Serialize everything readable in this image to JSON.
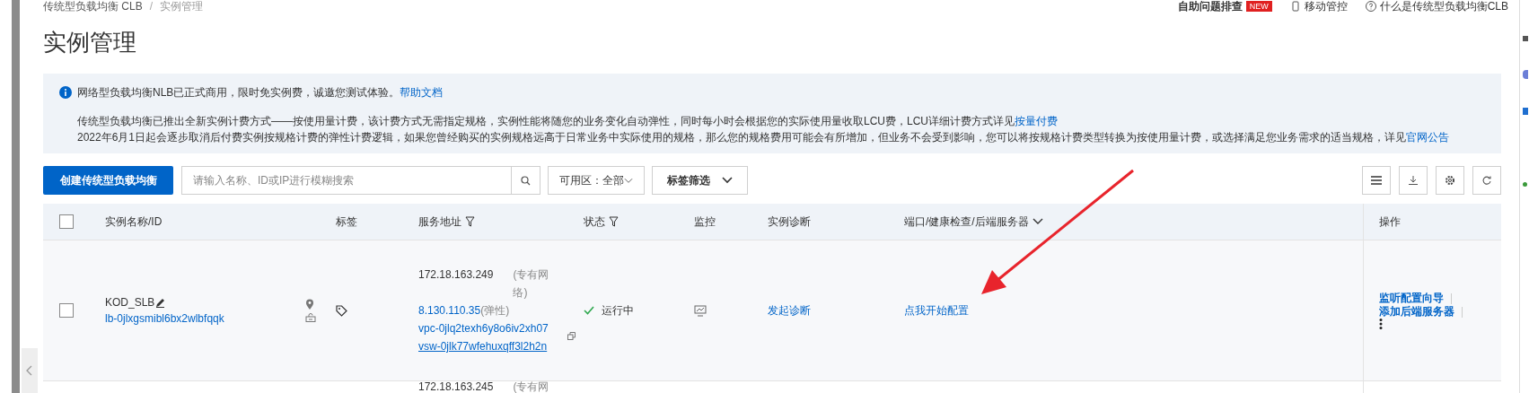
{
  "breadcrumb": {
    "separator": "/",
    "items": [
      {
        "label": "传统型负载均衡 CLB"
      },
      {
        "label": "实例管理"
      }
    ]
  },
  "top_links": [
    {
      "label": "自助问题排查",
      "badge": "NEW"
    },
    {
      "label": "移动管控"
    },
    {
      "label": "什么是传统型负载均衡CLB"
    }
  ],
  "page_title": "实例管理",
  "notice": {
    "line1": "网络型负载均衡NLB已正式商用，限时免实例费，诚邀您测试体验。",
    "line1_link": "帮助文档",
    "line2": "传统型负载均衡已推出全新实例计费方式——按使用量计费，该计费方式无需指定规格，实例性能将随您的业务变化自动弹性，同时每小时会根据您的实际使用量收取LCU费，LCU详细计费方式详见",
    "line2_link": "按量付费",
    "line3": "2022年6月1日起会逐步取消后付费实例按规格计费的弹性计费逻辑，如果您曾经购买的实例规格远高于日常业务中实际使用的规格，那么您的规格费用可能会有所增加，但业务不会受到影响，您可以将按规格计费类型转换为按使用量计费，或选择满足您业务需求的适当规格，详见",
    "line3_link": "官网公告"
  },
  "toolbar": {
    "create_button": "创建传统型负载均衡",
    "search": {
      "placeholder": "请输入名称、ID或IP进行模糊搜索"
    },
    "zone_filter": "可用区：全部",
    "tag_filter": "标签筛选"
  },
  "table": {
    "select_all_checked": false,
    "columns": [
      "实例名称/ID",
      "标签",
      "服务地址",
      "状态",
      "监控",
      "实例诊断",
      "端口/健康检查/后端服务器",
      "操作"
    ],
    "rows": [
      {
        "checked": false,
        "name": "KOD_SLB",
        "id": "lb-0jlxgsmibl6bx2wlbfqqk",
        "address": "172.18.163.249",
        "address_note": "(专有网络)",
        "public_ip": "8.130.110.35",
        "public_ip_note": "(弹性)",
        "vpc": "vpc-0jlq2texh6y8o6iv2xh07",
        "vsw": "vsw-0jlk77wfehuxqff3l2h2n",
        "status": "运行中",
        "diagnose": "发起诊断",
        "port_config": "点我开始配置",
        "actions": [
          "监听配置向导",
          "添加后端服务器"
        ]
      }
    ],
    "partial_row": {
      "address": "172.18.163.245",
      "address_note": "(专有网"
    }
  }
}
